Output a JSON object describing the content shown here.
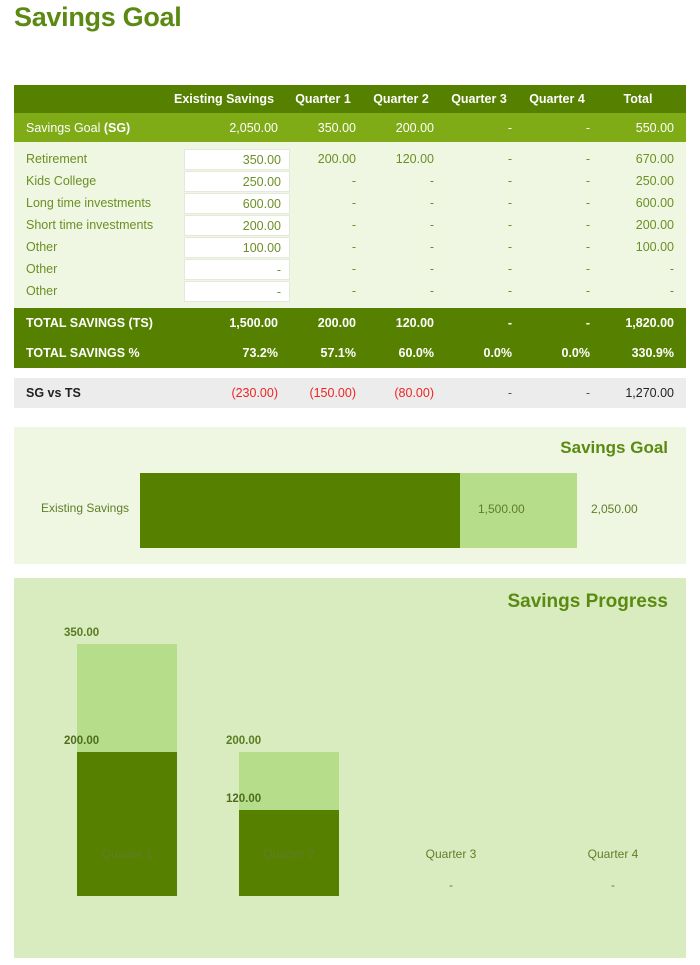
{
  "page_title": "Savings Goal",
  "colors": {
    "dark_green": "#558000",
    "mid_green": "#7eab16",
    "light_green_bar": "#b5dd8a",
    "panel_light": "#eff7e2",
    "panel_mid": "#d9ecbf",
    "negative_red": "#ef2424",
    "title_green": "#5a8a11",
    "vs_row_bg": "#ececec"
  },
  "table": {
    "columns": [
      "",
      "Existing Savings",
      "Quarter 1",
      "Quarter 2",
      "Quarter 3",
      "Quarter 4",
      "Total"
    ],
    "savings_goal_row": {
      "label_plain": "Savings Goal ",
      "label_bold": "(SG)",
      "existing_savings": "2,050.00",
      "q1": "350.00",
      "q2": "200.00",
      "q3": "-",
      "q4": "-",
      "total": "550.00"
    },
    "rows": [
      {
        "label": "Retirement",
        "existing_savings": "350.00",
        "q1": "200.00",
        "q2": "120.00",
        "q3": "-",
        "q4": "-",
        "total": "670.00"
      },
      {
        "label": "Kids College",
        "existing_savings": "250.00",
        "q1": "-",
        "q2": "-",
        "q3": "-",
        "q4": "-",
        "total": "250.00"
      },
      {
        "label": "Long time investments",
        "existing_savings": "600.00",
        "q1": "-",
        "q2": "-",
        "q3": "-",
        "q4": "-",
        "total": "600.00"
      },
      {
        "label": "Short time investments",
        "existing_savings": "200.00",
        "q1": "-",
        "q2": "-",
        "q3": "-",
        "q4": "-",
        "total": "200.00"
      },
      {
        "label": "Other",
        "existing_savings": "100.00",
        "q1": "-",
        "q2": "-",
        "q3": "-",
        "q4": "-",
        "total": "100.00"
      },
      {
        "label": "Other",
        "existing_savings": "-",
        "q1": "-",
        "q2": "-",
        "q3": "-",
        "q4": "-",
        "total": "-"
      },
      {
        "label": "Other",
        "existing_savings": "-",
        "q1": "-",
        "q2": "-",
        "q3": "-",
        "q4": "-",
        "total": "-"
      }
    ],
    "total_savings_row": {
      "label": "TOTAL SAVINGS (TS)",
      "existing_savings": "1,500.00",
      "q1": "200.00",
      "q2": "120.00",
      "q3": "-",
      "q4": "-",
      "total": "1,820.00"
    },
    "total_savings_pct_row": {
      "label": "TOTAL SAVINGS %",
      "existing_savings": "73.2%",
      "q1": "57.1%",
      "q2": "60.0%",
      "q3": "0.0%",
      "q4": "0.0%",
      "total": "330.9%"
    },
    "sg_vs_ts_row": {
      "label": "SG vs TS",
      "existing_savings": "(230.00)",
      "q1": "(150.00)",
      "q2": "(80.00)",
      "q3": "-",
      "q4": "-",
      "total": "1,270.00"
    }
  },
  "chart_data": [
    {
      "type": "bar",
      "orientation": "horizontal",
      "title": "Savings Goal",
      "categories": [
        "Existing Savings"
      ],
      "series": [
        {
          "name": "Savings Goal",
          "values": [
            2050
          ],
          "labels": [
            "2,050.00"
          ],
          "color": "#b5dd8a"
        },
        {
          "name": "Total Savings",
          "values": [
            1500
          ],
          "labels": [
            "1,500.00"
          ],
          "color": "#558000"
        }
      ],
      "xlabel": "",
      "ylabel": "",
      "xlim": [
        0,
        2050
      ],
      "grid": false,
      "legend": "none"
    },
    {
      "type": "bar",
      "orientation": "vertical",
      "title": "Savings Progress",
      "categories": [
        "Quarter 1",
        "Quarter 2",
        "Quarter 3",
        "Quarter 4"
      ],
      "series": [
        {
          "name": "Savings Goal",
          "values": [
            350,
            200,
            null,
            null
          ],
          "labels": [
            "350.00",
            "200.00",
            "-",
            "-"
          ],
          "color": "#b5dd8a"
        },
        {
          "name": "Total Savings",
          "values": [
            200,
            120,
            null,
            null
          ],
          "labels": [
            "200.00",
            "120.00",
            "-",
            "-"
          ],
          "color": "#558000"
        }
      ],
      "xlabel": "",
      "ylabel": "",
      "ylim": [
        0,
        350
      ],
      "grid": false,
      "legend": "none"
    }
  ]
}
